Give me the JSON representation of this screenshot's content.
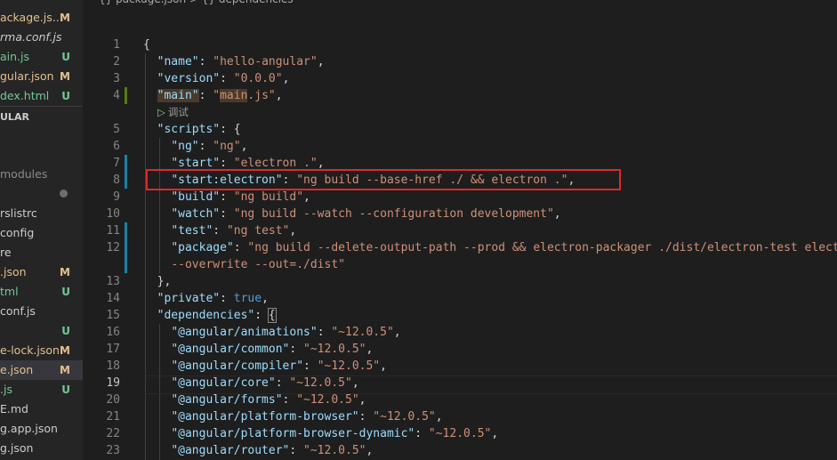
{
  "sidebar": {
    "items": [
      {
        "name": "ackage.js...",
        "status": "M",
        "color": "#e2c08d"
      },
      {
        "name": "rma.conf.js",
        "status": "",
        "color": "#cccccc"
      },
      {
        "name": "ain.js",
        "status": "U",
        "color": "#73c991"
      },
      {
        "name": "gular.json",
        "status": "M",
        "color": "#e2c08d"
      },
      {
        "name": "dex.html",
        "status": "U",
        "color": "#73c991"
      }
    ],
    "section_header": "ULAR",
    "items2": [
      {
        "name": "modules",
        "status": "",
        "color": "#8b8b8b"
      },
      {
        "name": "rslistrc",
        "status": "",
        "color": "#cccccc"
      },
      {
        "name": "config",
        "status": "",
        "color": "#cccccc"
      },
      {
        "name": "re",
        "status": "",
        "color": "#cccccc"
      },
      {
        "name": ".json",
        "status": "M",
        "color": "#e2c08d"
      },
      {
        "name": "tml",
        "status": "U",
        "color": "#73c991"
      },
      {
        "name": "conf.js",
        "status": "",
        "color": "#cccccc"
      },
      {
        "name": "",
        "status": "U",
        "color": "#73c991"
      },
      {
        "name": "e-lock.json",
        "status": "M",
        "color": "#e2c08d"
      },
      {
        "name": "e.json",
        "status": "M",
        "color": "#e2c08d"
      },
      {
        "name": ".js",
        "status": "U",
        "color": "#73c991"
      },
      {
        "name": "E.md",
        "status": "",
        "color": "#cccccc"
      },
      {
        "name": "g.app.json",
        "status": "",
        "color": "#cccccc"
      },
      {
        "name": "g.json",
        "status": "",
        "color": "#cccccc"
      }
    ]
  },
  "breadcrumb": "{} package.json > {} dependencies",
  "codelens": {
    "arrow": "▷",
    "label": "调试"
  },
  "lines": [
    "1",
    "2",
    "3",
    "4",
    "5",
    "6",
    "7",
    "8",
    "9",
    "10",
    "11",
    "12",
    "13",
    "14",
    "15",
    "16",
    "17",
    "18",
    "19",
    "20",
    "21",
    "22",
    "23"
  ],
  "code": {
    "l1": "{",
    "l2k": "\"name\"",
    "l2v": "\"hello-angular\"",
    "l3k": "\"version\"",
    "l3v": "\"0.0.0\"",
    "l4k": "\"main\"",
    "l4q1": "\"",
    "l4v": "main",
    "l4q2": ".js\"",
    "l5k": "\"scripts\"",
    "l5v": "{",
    "l6k": "\"ng\"",
    "l6v": "\"ng\"",
    "l7k": "\"start\"",
    "l7v": "\"electron .\"",
    "l8k": "\"start:electron\"",
    "l8v": "\"ng build --base-href ./ && electron .\"",
    "l9k": "\"build\"",
    "l9v": "\"ng build\"",
    "l10k": "\"watch\"",
    "l10v": "\"ng build --watch --configuration development\"",
    "l11k": "\"test\"",
    "l11v": "\"ng test\"",
    "l12k": "\"package\"",
    "l12v": "\"ng build --delete-output-path --prod && electron-packager ./dist/electron-test electron",
    "l12w": "--overwrite --out=./dist\"",
    "l13": "},",
    "l14k": "\"private\"",
    "l14v": "true",
    "l15k": "\"dependencies\"",
    "l15v": "{",
    "l16k": "\"@angular/animations\"",
    "l16v": "\"~12.0.5\"",
    "l17k": "\"@angular/common\"",
    "l17v": "\"~12.0.5\"",
    "l18k": "\"@angular/compiler\"",
    "l18v": "\"~12.0.5\"",
    "l19k": "\"@angular/core\"",
    "l19v": "\"~12.0.5\"",
    "l20k": "\"@angular/forms\"",
    "l20v": "\"~12.0.5\"",
    "l21k": "\"@angular/platform-browser\"",
    "l21v": "\"~12.0.5\"",
    "l22k": "\"@angular/platform-browser-dynamic\"",
    "l22v": "\"~12.0.5\"",
    "l23k": "\"@angular/router\"",
    "l23v": "\"~12.0.5\""
  },
  "colors": {
    "highlight_box": "#e0282a",
    "modified": "#e2c08d",
    "untracked": "#73c991"
  }
}
